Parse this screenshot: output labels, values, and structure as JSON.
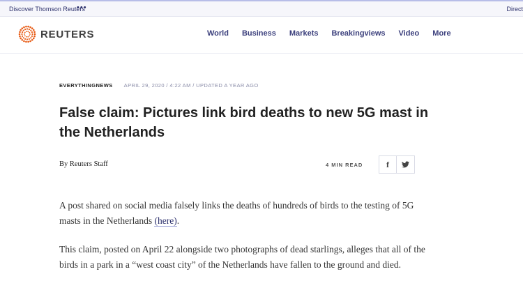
{
  "topbar": {
    "discover_label": "Discover Thomson Reuters",
    "more_dots": "•••",
    "directory_label": "Direct"
  },
  "brand": {
    "name": "REUTERS",
    "logo_color": "#e85c16"
  },
  "nav": {
    "items": [
      "World",
      "Business",
      "Markets",
      "Breakingviews",
      "Video",
      "More"
    ]
  },
  "article": {
    "section": "EVERYTHINGNEWS",
    "dateline": "APRIL 29, 2020 / 4:22 AM / UPDATED A YEAR AGO",
    "headline": "False claim: Pictures link bird deaths to new 5G mast in the Netherlands",
    "byline": "By Reuters Staff",
    "read_time": "4 MIN READ",
    "share": {
      "facebook_icon": "facebook-icon",
      "twitter_icon": "twitter-icon"
    },
    "p1_before": "A post shared on social media falsely links the deaths of hundreds of birds to the testing of 5G masts in the Netherlands ",
    "p1_link": "(here)",
    "p1_after": ".",
    "p2": "This claim, posted on April 22 alongside two photographs of dead starlings, alleges that all of the birds in a park in a “west coast city” of the Netherlands have fallen to the ground and died."
  }
}
